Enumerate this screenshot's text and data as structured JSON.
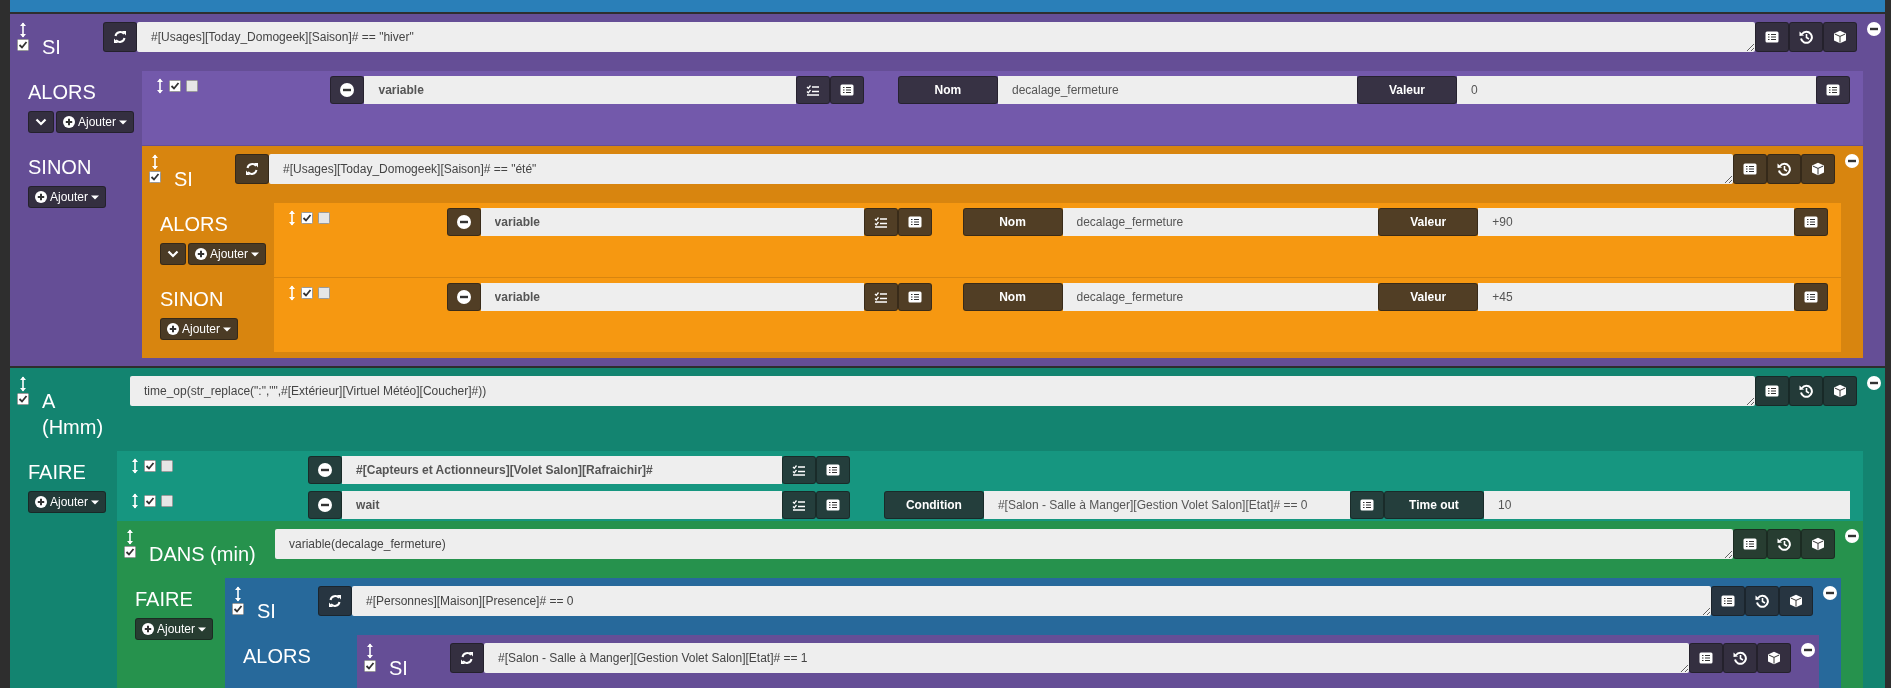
{
  "blocks": [
    {
      "kind": "if",
      "label": "SI",
      "enabled": true,
      "color": "#654e96",
      "expression": "#[Usages][Today_Domogeek][Saison]# == \"hiver\"",
      "sections": [
        {
          "label": "ALORS",
          "collapse_button": true,
          "add_button": "Ajouter",
          "items": [
            {
              "kind": "action",
              "enabled": true,
              "parallel": false,
              "command": "variable",
              "options": [
                {
                  "label": "Nom",
                  "value": "decalage_fermeture",
                  "list_button": false
                },
                {
                  "label": "Valeur",
                  "value": "0",
                  "list_button": true
                }
              ]
            }
          ]
        },
        {
          "label": "SINON",
          "collapse_button": false,
          "add_button": "Ajouter",
          "items": [
            {
              "kind": "block",
              "block": {
                "kind": "if",
                "label": "SI",
                "enabled": true,
                "color": "#d8850f",
                "expression": "#[Usages][Today_Domogeek][Saison]# == \"été\"",
                "sections": [
                  {
                    "label": "ALORS",
                    "collapse_button": true,
                    "add_button": "Ajouter",
                    "items": [
                      {
                        "kind": "action",
                        "enabled": true,
                        "parallel": false,
                        "command": "variable",
                        "options": [
                          {
                            "label": "Nom",
                            "value": "decalage_fermeture",
                            "list_button": false
                          },
                          {
                            "label": "Valeur",
                            "value": "+90",
                            "list_button": true
                          }
                        ]
                      }
                    ]
                  },
                  {
                    "label": "SINON",
                    "collapse_button": false,
                    "add_button": "Ajouter",
                    "items": [
                      {
                        "kind": "action",
                        "enabled": true,
                        "parallel": false,
                        "command": "variable",
                        "options": [
                          {
                            "label": "Nom",
                            "value": "decalage_fermeture",
                            "list_button": false
                          },
                          {
                            "label": "Valeur",
                            "value": "+45",
                            "list_button": true
                          }
                        ]
                      }
                    ]
                  }
                ]
              }
            }
          ]
        }
      ]
    },
    {
      "kind": "at",
      "label": "A (Hmm)",
      "enabled": true,
      "color": "#138470",
      "expression": "time_op(str_replace(\":\",\"\",#[Extérieur][Virtuel Météo][Coucher]#))",
      "sections": [
        {
          "label": "FAIRE",
          "collapse_button": false,
          "add_button": "Ajouter",
          "items": [
            {
              "kind": "action",
              "enabled": true,
              "parallel": false,
              "command": "#[Capteurs et Actionneurs][Volet Salon][Rafraichir]#"
            },
            {
              "kind": "action",
              "enabled": true,
              "parallel": false,
              "command": "wait",
              "options": [
                {
                  "label": "Condition",
                  "value": "#[Salon - Salle à Manger][Gestion Volet Salon][Etat]# == 0",
                  "list_button": true
                },
                {
                  "label": "Time out",
                  "value": "10",
                  "list_button": false
                }
              ]
            },
            {
              "kind": "block",
              "block": {
                "kind": "in",
                "label": "DANS (min)",
                "enabled": true,
                "color": "#26924d",
                "expression": "variable(decalage_fermeture)",
                "sections": [
                  {
                    "label": "FAIRE",
                    "collapse_button": false,
                    "add_button": "Ajouter",
                    "items": [
                      {
                        "kind": "block",
                        "block": {
                          "kind": "if",
                          "label": "SI",
                          "enabled": true,
                          "color": "#27699b",
                          "expression": "#[Personnes][Maison][Presence]# == 0",
                          "sections": [
                            {
                              "label": "ALORS",
                              "collapse_button": false,
                              "items": [
                                {
                                  "kind": "block",
                                  "block": {
                                    "kind": "if",
                                    "label": "SI",
                                    "enabled": true,
                                    "color": "#654e96",
                                    "expression": "#[Salon - Salle à Manger][Gestion Volet Salon][Etat]# == 1"
                                  }
                                }
                              ]
                            }
                          ]
                        }
                      }
                    ]
                  }
                ]
              }
            }
          ]
        }
      ]
    }
  ]
}
